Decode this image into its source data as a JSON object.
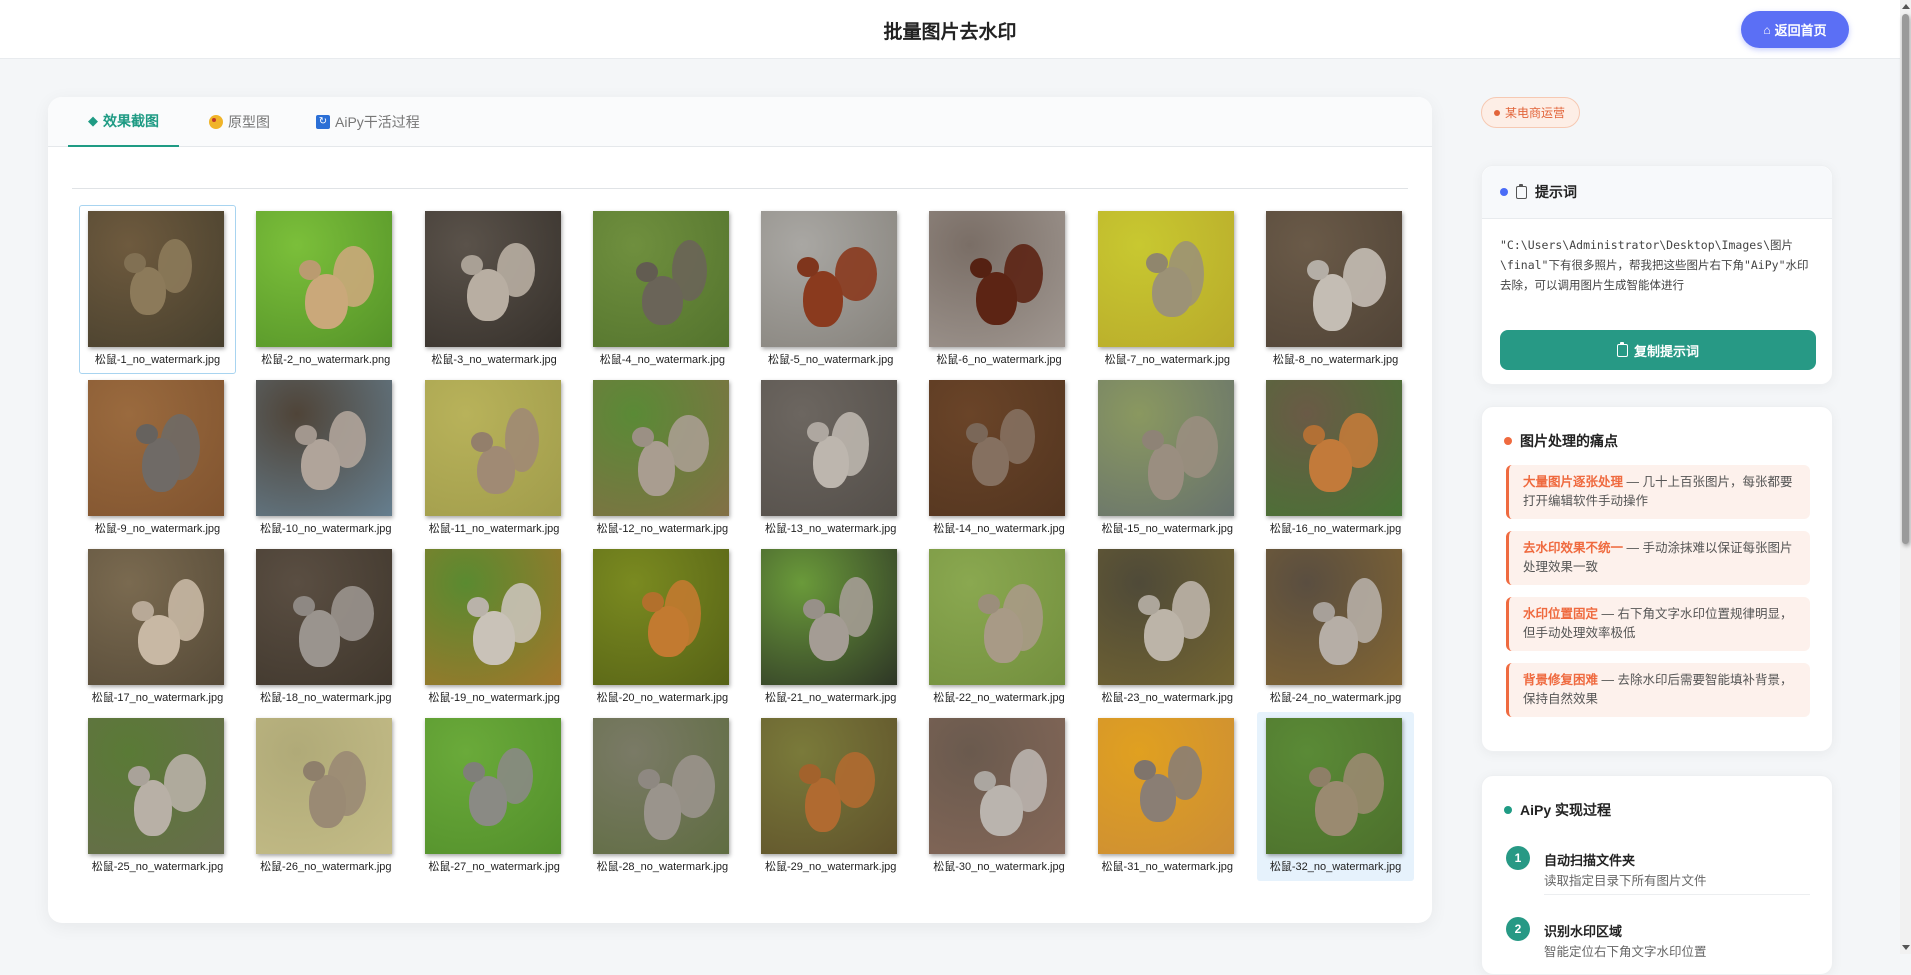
{
  "header": {
    "title": "批量图片去水印",
    "home_label": "返回首页"
  },
  "tabs": [
    {
      "label": "效果截图",
      "icon": "diamond-icon"
    },
    {
      "label": "原型图",
      "icon": "palette-icon"
    },
    {
      "label": "AiPy干活过程",
      "icon": "refresh-icon"
    }
  ],
  "images": [
    {
      "caption": "松鼠-1_no_watermark.jpg",
      "tones": [
        "#6e5a3e",
        "#8c7a5a",
        "#3f3a2a"
      ]
    },
    {
      "caption": "松鼠-2_no_watermark.png",
      "tones": [
        "#7bbf3a",
        "#caa87a",
        "#4d8a25"
      ]
    },
    {
      "caption": "松鼠-3_no_watermark.jpg",
      "tones": [
        "#5a524a",
        "#b8aea2",
        "#2f2a25"
      ]
    },
    {
      "caption": "松鼠-4_no_watermark.jpg",
      "tones": [
        "#6f8f3e",
        "#6a6458",
        "#4e6e2a"
      ]
    },
    {
      "caption": "松鼠-5_no_watermark.jpg",
      "tones": [
        "#a9a7a3",
        "#8a3a1e",
        "#7f7b74"
      ]
    },
    {
      "caption": "松鼠-6_no_watermark.jpg",
      "tones": [
        "#7a6e66",
        "#5c2414",
        "#a8a09a"
      ]
    },
    {
      "caption": "松鼠-7_no_watermark.jpg",
      "tones": [
        "#c8c830",
        "#9c9276",
        "#b5a42a"
      ]
    },
    {
      "caption": "松鼠-8_no_watermark.jpg",
      "tones": [
        "#6a5a48",
        "#c4bdb4",
        "#4b3f33"
      ]
    },
    {
      "caption": "松鼠-9_no_watermark.jpg",
      "tones": [
        "#9a6a3e",
        "#6f6a66",
        "#7b4f2c"
      ]
    },
    {
      "caption": "松鼠-10_no_watermark.jpg",
      "tones": [
        "#4f4438",
        "#b0a49a",
        "#6a8aa0"
      ]
    },
    {
      "caption": "松鼠-11_no_watermark.jpg",
      "tones": [
        "#b8b25a",
        "#a08a74",
        "#9c9848"
      ]
    },
    {
      "caption": "松鼠-12_no_watermark.jpg",
      "tones": [
        "#5a8a36",
        "#a99d90",
        "#8a6a48"
      ]
    },
    {
      "caption": "松鼠-13_no_watermark.jpg",
      "tones": [
        "#6c6660",
        "#bdb6ae",
        "#4f4a45"
      ]
    },
    {
      "caption": "松鼠-14_no_watermark.jpg",
      "tones": [
        "#6a4428",
        "#857060",
        "#4e321e"
      ]
    },
    {
      "caption": "松鼠-15_no_watermark.jpg",
      "tones": [
        "#8a9860",
        "#9a8e80",
        "#606a70"
      ]
    },
    {
      "caption": "松鼠-16_no_watermark.jpg",
      "tones": [
        "#6a5a46",
        "#c27a3a",
        "#3f7a30"
      ]
    },
    {
      "caption": "松鼠-17_no_watermark.jpg",
      "tones": [
        "#7a6a50",
        "#c8b8a4",
        "#4f4433"
      ]
    },
    {
      "caption": "松鼠-18_no_watermark.jpg",
      "tones": [
        "#5a4e42",
        "#9a948e",
        "#3a3228"
      ]
    },
    {
      "caption": "松鼠-19_no_watermark.jpg",
      "tones": [
        "#5a8a30",
        "#c9c2b8",
        "#b0722a"
      ]
    },
    {
      "caption": "松鼠-20_no_watermark.jpg",
      "tones": [
        "#7a8a20",
        "#c27a30",
        "#4f5a14"
      ]
    },
    {
      "caption": "松鼠-21_no_watermark.jpg",
      "tones": [
        "#6a9a3a",
        "#a49c94",
        "#222222"
      ]
    },
    {
      "caption": "松鼠-22_no_watermark.jpg",
      "tones": [
        "#8aa850",
        "#a89a86",
        "#6e8a3a"
      ]
    },
    {
      "caption": "松鼠-23_no_watermark.jpg",
      "tones": [
        "#4f4a38",
        "#bcb4a8",
        "#7a6a30"
      ]
    },
    {
      "caption": "松鼠-24_no_watermark.jpg",
      "tones": [
        "#5a4e40",
        "#b6aea6",
        "#8a6a30"
      ]
    },
    {
      "caption": "松鼠-25_no_watermark.jpg",
      "tones": [
        "#5a7a36",
        "#b8b0a6",
        "#6a6a50"
      ]
    },
    {
      "caption": "松鼠-26_no_watermark.jpg",
      "tones": [
        "#b0aa78",
        "#9a8a74",
        "#c8c08a"
      ]
    },
    {
      "caption": "松鼠-27_no_watermark.jpg",
      "tones": [
        "#6aaa3a",
        "#8a8a84",
        "#4e8a28"
      ]
    },
    {
      "caption": "松鼠-28_no_watermark.jpg",
      "tones": [
        "#7a7a66",
        "#9a948c",
        "#5a6a3a"
      ]
    },
    {
      "caption": "松鼠-29_no_watermark.jpg",
      "tones": [
        "#7a7a3a",
        "#b06a30",
        "#5a4a28"
      ]
    },
    {
      "caption": "松鼠-30_no_watermark.jpg",
      "tones": [
        "#6a5a4e",
        "#bab4ae",
        "#8a6a5a"
      ]
    },
    {
      "caption": "松鼠-31_no_watermark.jpg",
      "tones": [
        "#e0a020",
        "#8a7e74",
        "#c88a3a"
      ]
    },
    {
      "caption": "松鼠-32_no_watermark.jpg",
      "tones": [
        "#5a8a36",
        "#9a8a70",
        "#4a6a2a"
      ]
    }
  ],
  "sidebar": {
    "tag": "某电商运营",
    "prompt_title": "提示词",
    "prompt_text": "\"C:\\Users\\Administrator\\Desktop\\Images\\图片\\final\"下有很多照片，帮我把这些图片右下角\"AiPy\"水印去除，可以调用图片生成智能体进行",
    "copy_label": "复制提示词",
    "pain_title": "图片处理的痛点",
    "pains": [
      {
        "highlight": "大量图片逐张处理",
        "text": " — 几十上百张图片，每张都要打开编辑软件手动操作"
      },
      {
        "highlight": "去水印效果不统一",
        "text": " — 手动涂抹难以保证每张图片处理效果一致"
      },
      {
        "highlight": "水印位置固定",
        "text": " — 右下角文字水印位置规律明显，但手动处理效率极低"
      },
      {
        "highlight": "背景修复困难",
        "text": " — 去除水印后需要智能填补背景，保持自然效果"
      }
    ],
    "steps_title": "AiPy 实现过程",
    "steps": [
      {
        "num": "1",
        "title": "自动扫描文件夹",
        "desc": "读取指定目录下所有图片文件"
      },
      {
        "num": "2",
        "title": "识别水印区域",
        "desc": "智能定位右下角文字水印位置"
      }
    ]
  },
  "colors": {
    "accent": "#279985",
    "home_button": "#5b6ff5",
    "pain_accent": "#ef6a3f"
  }
}
